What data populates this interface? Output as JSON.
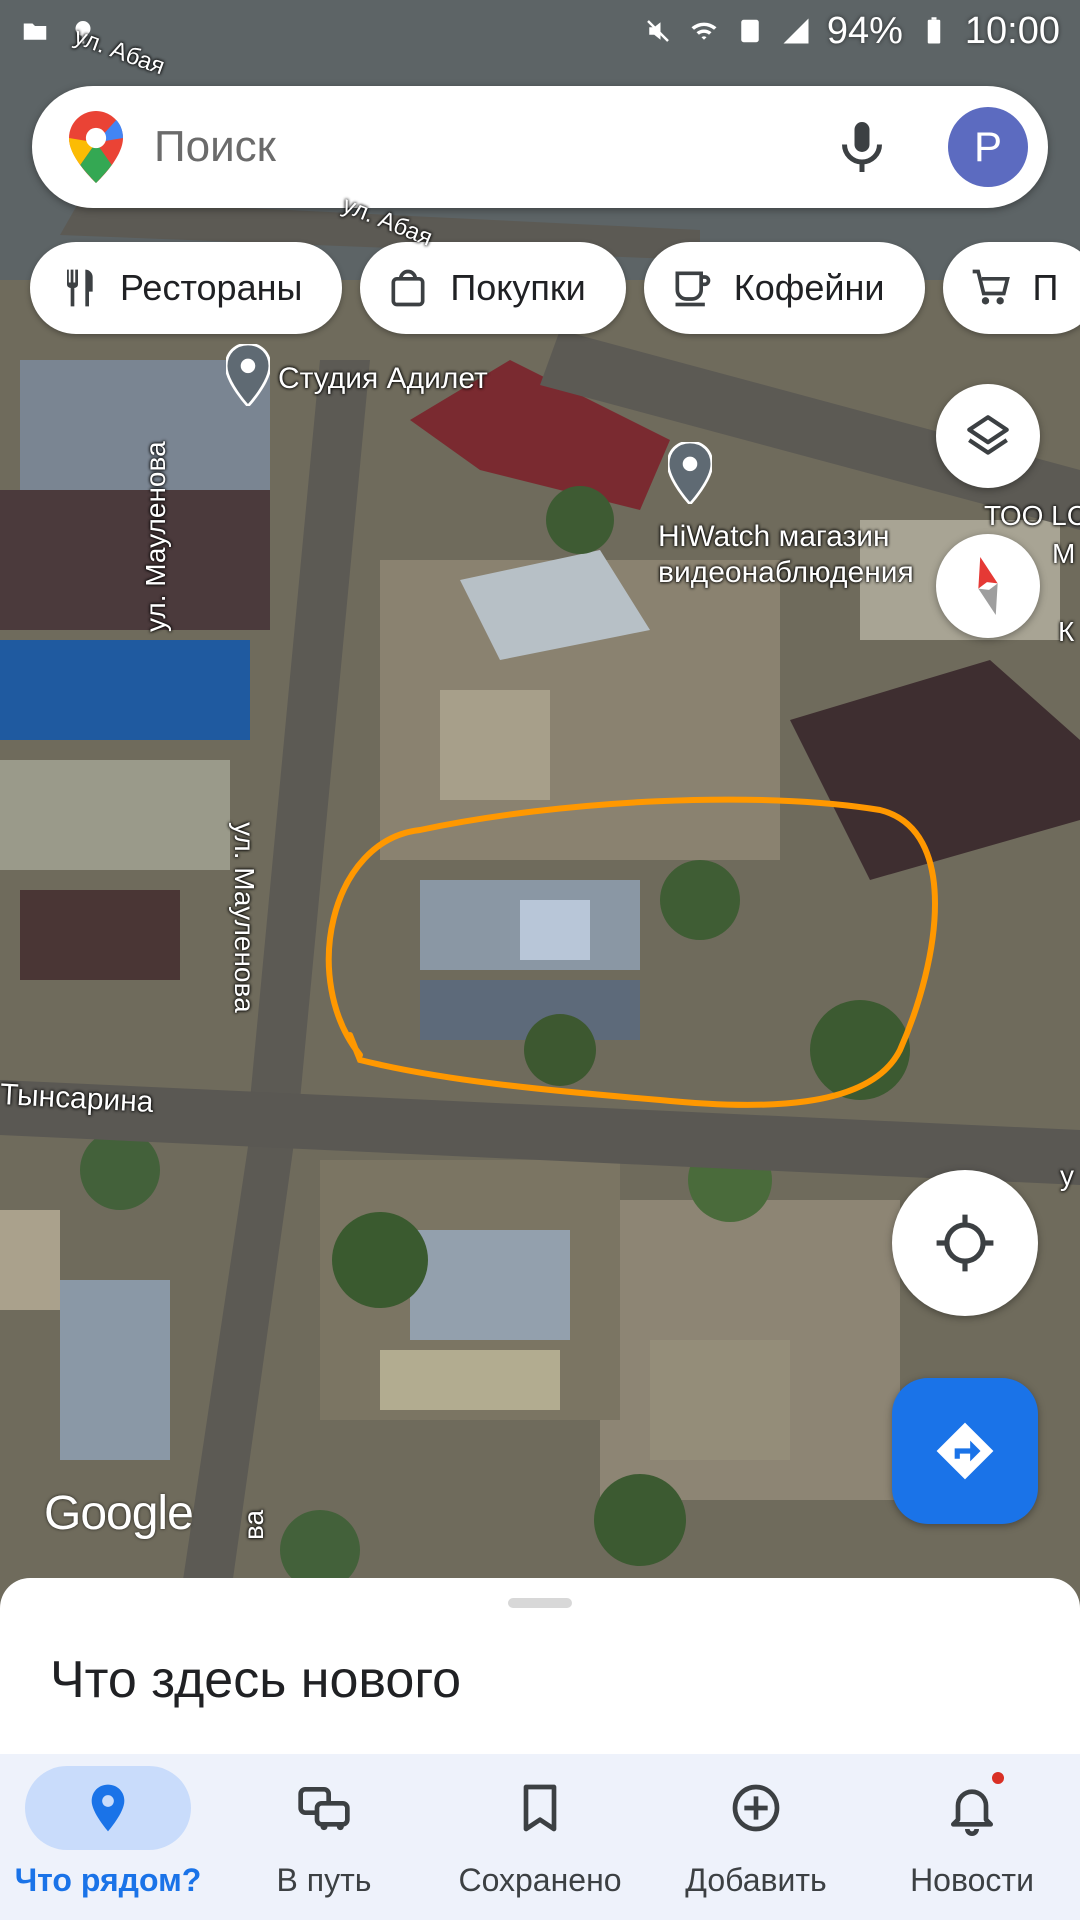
{
  "status_bar": {
    "battery": "94%",
    "time": "10:00",
    "icons": [
      "folder-icon",
      "location-icon",
      "mute-icon",
      "wifi-icon",
      "notification-icon",
      "signal-icon",
      "battery-icon"
    ]
  },
  "search": {
    "placeholder": "Поиск",
    "avatar_letter": "P",
    "icons": [
      "maps-logo-icon",
      "mic-icon"
    ]
  },
  "chips": [
    {
      "label": "Рестораны",
      "icon": "restaurant-icon"
    },
    {
      "label": "Покупки",
      "icon": "shopping-bag-icon"
    },
    {
      "label": "Кофейни",
      "icon": "coffee-icon"
    },
    {
      "label": "П",
      "icon": "cart-icon"
    }
  ],
  "map_labels": {
    "street_abay_top": "ул. Абая",
    "street_abay_mid": "ул. Абая",
    "street_maulenova_1": "ул. Мауленова",
    "street_maulenova_2": "ул. Мауленова",
    "street_altynsarina": "Тынсарина",
    "street_bottom_fragment": "ва",
    "street_right_fragment": "у",
    "poi_studio": "Студия Адилет",
    "poi_hiwatch_line1": "HiWatch магазин",
    "poi_hiwatch_line2": "видеонаблюдения",
    "poi_too_line1": "ТОО LC",
    "poi_too_line2": "М",
    "poi_k": "К"
  },
  "map_controls": {
    "icons": [
      "layers-icon",
      "compass-icon",
      "my-location-icon",
      "directions-icon"
    ]
  },
  "google_logo": "Google",
  "colors": {
    "accent": "#1a73e8",
    "annotation": "#ff9800",
    "nav_active_bg": "#c9dcfb"
  },
  "bottom_sheet": {
    "title": "Что здесь нового"
  },
  "bottom_nav": [
    {
      "label": "Что рядом?",
      "icon": "explore-pin-icon",
      "active": true
    },
    {
      "label": "В путь",
      "icon": "commute-icon",
      "active": false
    },
    {
      "label": "Сохранено",
      "icon": "bookmark-icon",
      "active": false
    },
    {
      "label": "Добавить",
      "icon": "add-circle-icon",
      "active": false
    },
    {
      "label": "Новости",
      "icon": "bell-icon",
      "active": false,
      "badge": true
    }
  ]
}
